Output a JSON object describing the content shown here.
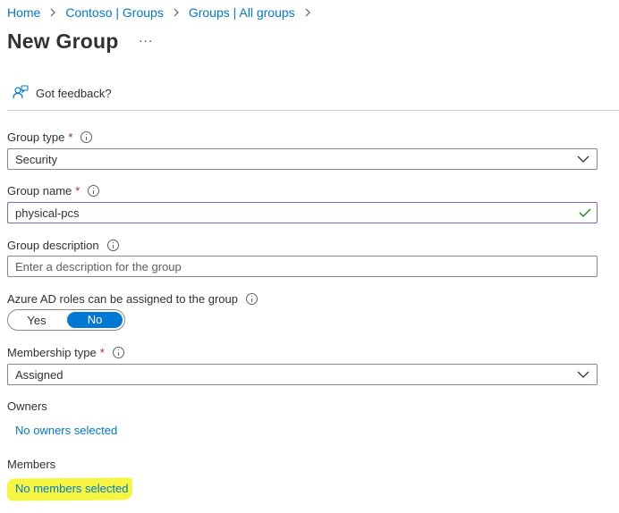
{
  "breadcrumb": {
    "items": [
      "Home",
      "Contoso | Groups",
      "Groups | All groups"
    ]
  },
  "page": {
    "title": "New Group",
    "more_label": "..."
  },
  "toolbar": {
    "feedback_label": "Got feedback?"
  },
  "form": {
    "group_type": {
      "label": "Group type",
      "required_mark": "*",
      "value": "Security"
    },
    "group_name": {
      "label": "Group name",
      "required_mark": "*",
      "value": "physical-pcs"
    },
    "group_description": {
      "label": "Group description",
      "placeholder": "Enter a description for the group",
      "value": ""
    },
    "azure_ad_roles": {
      "label": "Azure AD roles can be assigned to the group",
      "yes_label": "Yes",
      "no_label": "No",
      "selected": "No"
    },
    "membership_type": {
      "label": "Membership type",
      "required_mark": "*",
      "value": "Assigned"
    },
    "owners": {
      "label": "Owners",
      "link": "No owners selected"
    },
    "members": {
      "label": "Members",
      "link": "No members selected"
    }
  },
  "colors": {
    "link": "#0078d4",
    "required": "#a4262c",
    "toggle_on": "#0078d4",
    "valid_check": "#107c10",
    "focus_border": "#8764b8",
    "highlight": "#f5f542"
  }
}
